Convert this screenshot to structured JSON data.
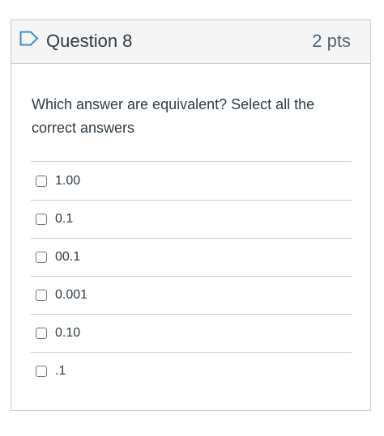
{
  "question": {
    "title": "Question 8",
    "points": "2 pts",
    "text": "Which answer are equivalent?  Select all the correct answers",
    "answers": [
      {
        "label": "1.00",
        "checked": false
      },
      {
        "label": "0.1",
        "checked": false
      },
      {
        "label": "00.1",
        "checked": false
      },
      {
        "label": "0.001",
        "checked": false
      },
      {
        "label": "0.10",
        "checked": false
      },
      {
        "label": ".1",
        "checked": false
      }
    ]
  },
  "colors": {
    "flag": "#3a8ec6",
    "header_bg": "#f5f5f5",
    "border": "#c7cdd1",
    "text": "#2d3b45"
  },
  "icons": {
    "flag": "flag-icon",
    "checkbox": "checkbox-icon"
  }
}
